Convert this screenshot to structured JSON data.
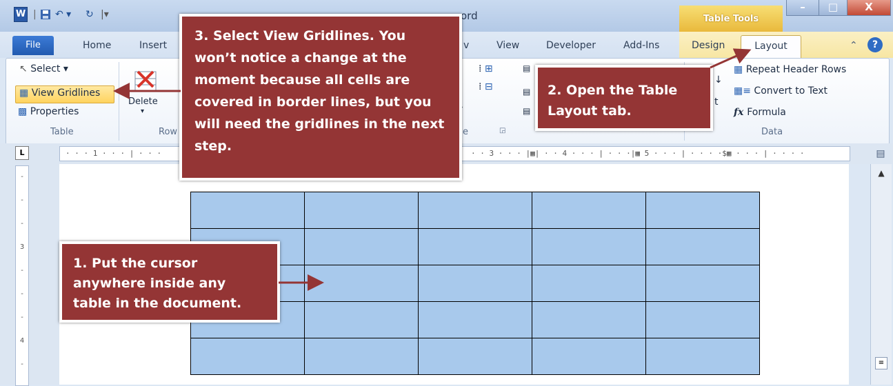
{
  "qat": {
    "app_icon_letter": "W"
  },
  "title": {
    "partial": "ord"
  },
  "table_tools": {
    "label": "Table Tools"
  },
  "window": {
    "minimize": "–",
    "maximize": "□",
    "close": "X"
  },
  "tabs": {
    "file": "File",
    "home": "Home",
    "insert": "Insert",
    "review_partial": "v",
    "view": "View",
    "developer": "Developer",
    "addins": "Add-Ins",
    "design": "Design",
    "layout": "Layout"
  },
  "ribbon": {
    "table_group": {
      "select": "Select ▾",
      "view_gridlines": "View Gridlines",
      "properties": "Properties",
      "label": "Table"
    },
    "rows_group": {
      "delete": "Delete",
      "label_partial": "Row"
    },
    "alignment_partial": {
      "text_direction_partial": "t",
      "label_partial": "e"
    },
    "data_group": {
      "repeat_header": "Repeat Header Rows",
      "convert": "Convert to Text",
      "formula": "Formula",
      "label": "Data"
    }
  },
  "ruler": {
    "corner": "L",
    "marks": "· · · 1 · · · | · · ·",
    "marks_right": "· · 3 · · · |▦| · · 4 · · · | · · ·|▦ 5 · · · | · · · ·$▦ · · · | · · · ·",
    "v_marks": [
      "-",
      "-",
      "-",
      "3",
      "-",
      "-",
      "-",
      "4",
      "-"
    ]
  },
  "table": {
    "rows": 5,
    "cols": 5
  },
  "callouts": {
    "step1": "1. Put the cursor anywhere inside any table in the document.",
    "step2": "2. Open the Table Layout tab.",
    "step3": "3. Select View Gridlines. You won’t notice a change at the moment because all cells are covered in border lines, but you will need the gridlines in the next step."
  },
  "colors": {
    "callout": "#943535",
    "table_fill": "#a8c9ec",
    "selected_button": "#ffd35e"
  }
}
